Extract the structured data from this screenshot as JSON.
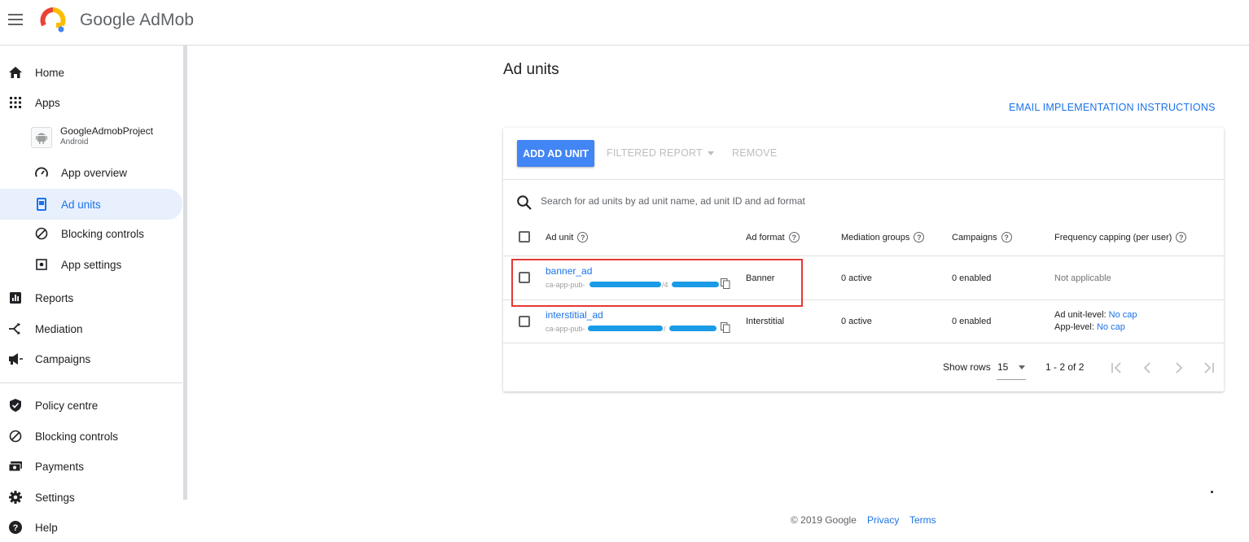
{
  "header": {
    "brand_google": "Google",
    "brand_product": "AdMob"
  },
  "sidebar": {
    "home": "Home",
    "apps": "Apps",
    "app": {
      "name": "GoogleAdmobProject",
      "platform": "Android"
    },
    "app_overview": "App overview",
    "ad_units": "Ad units",
    "blocking_controls_app": "Blocking controls",
    "app_settings": "App settings",
    "reports": "Reports",
    "mediation": "Mediation",
    "campaigns": "Campaigns",
    "policy_centre": "Policy centre",
    "blocking_controls": "Blocking controls",
    "payments": "Payments",
    "settings": "Settings",
    "help": "Help"
  },
  "main": {
    "title": "Ad units",
    "email_link": "EMAIL IMPLEMENTATION INSTRUCTIONS",
    "toolbar": {
      "add": "ADD AD UNIT",
      "filtered": "FILTERED REPORT",
      "remove": "REMOVE"
    },
    "search": {
      "placeholder": "Search for ad units by ad unit name, ad unit ID and ad format"
    },
    "columns": [
      "Ad unit",
      "Ad format",
      "Mediation groups",
      "Campaigns",
      "Frequency capping (per user)"
    ],
    "rows": [
      {
        "name": "banner_ad",
        "id_prefix": "ca-app-pub-",
        "id_sep": "/4",
        "format": "Banner",
        "mediation": "0 active",
        "campaigns": "0 enabled",
        "freq_text": "Not applicable"
      },
      {
        "name": "interstitial_ad",
        "id_prefix": "ca-app-pub-",
        "id_sep": "/",
        "format": "Interstitial",
        "mediation": "0 active",
        "campaigns": "0 enabled",
        "freq_unit_label": "Ad unit-level: ",
        "freq_unit_val": "No cap",
        "freq_app_label": "App-level: ",
        "freq_app_val": "No cap"
      }
    ],
    "pagination": {
      "show_rows_label": "Show rows",
      "rows_value": "15",
      "range": "1 - 2 of 2"
    }
  },
  "footer": {
    "copyright": "© 2019 Google",
    "privacy": "Privacy",
    "terms": "Terms"
  }
}
